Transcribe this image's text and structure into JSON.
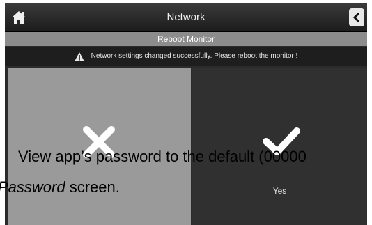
{
  "header": {
    "title": "Network"
  },
  "subheader": {
    "title": "Reboot Monitor"
  },
  "notice": {
    "message": "Network settings changed successfully. Please reboot the monitor !"
  },
  "dialog": {
    "yes_label": "Yes"
  },
  "overlay_text": {
    "line1": "View app’s password to the default (00000",
    "line2_italic": "Password",
    "line2_rest": " screen."
  },
  "icons": {
    "home": "home-icon",
    "back": "chevron-left-icon",
    "warning": "warning-icon",
    "no": "x-icon",
    "yes": "checkmark-icon"
  }
}
